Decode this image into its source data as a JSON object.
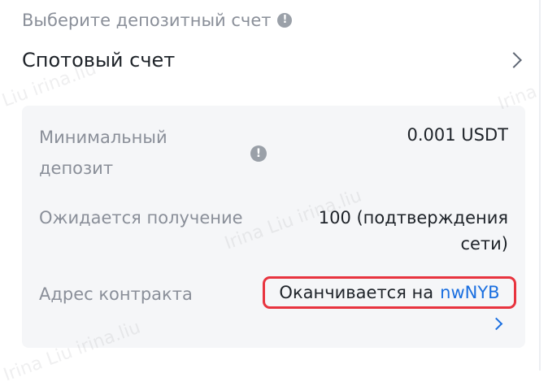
{
  "deposit_account": {
    "label": "Выберите депозитный счет",
    "selected": "Спотовый счет"
  },
  "details": {
    "min_deposit_label": "Минимальный депозит",
    "min_deposit_value": "0.001 USDT",
    "expected_receive_label": "Ожидается получение",
    "expected_receive_value": "100 (подтверждения сети)",
    "contract_address_label": "Адрес контракта",
    "contract_prefix": "Оканчивается на",
    "contract_suffix": "nwNYB"
  },
  "watermark": [
    "Liu irina.liu",
    "Irina Liu irina.liu",
    "Irina Liu irina.liu",
    "Irina"
  ],
  "colors": {
    "highlight_border": "#e8343f",
    "link_blue": "#1a6fe0",
    "muted_text": "#8a8f99",
    "panel_bg": "#f5f6f8"
  },
  "icons": [
    "info-icon",
    "chevron-right-icon",
    "link-chevron-icon"
  ]
}
